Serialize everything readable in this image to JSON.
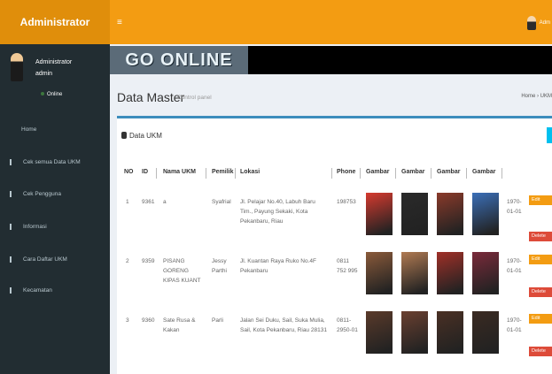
{
  "header": {
    "brand": "Administrator",
    "menu_icon": "hamburger-icon",
    "user_name": "Adm"
  },
  "sidebar": {
    "user": {
      "name_line1": "Administrator",
      "name_line2": "admin",
      "status": "Online"
    },
    "items": [
      {
        "label": "Home"
      },
      {
        "label": "Cek semua Data UKM"
      },
      {
        "label": "Cek Pengguna"
      },
      {
        "label": "Informasi"
      },
      {
        "label": "Cara Daftar UKM"
      },
      {
        "label": "Kecamatan"
      }
    ]
  },
  "banner": {
    "text": "GO ONLINE"
  },
  "content": {
    "title": "Data Master",
    "subtitle": "Control panel",
    "breadcrumb": "Home › UKM"
  },
  "box": {
    "title": "Data UKM",
    "columns": [
      "NO",
      "ID",
      "Nama UKM",
      "Pemilik",
      "Lokasi",
      "Phone",
      "Gambar",
      "Gambar",
      "Gambar",
      "Gambar"
    ],
    "rows": [
      {
        "no": "1",
        "id": "9361",
        "nama": "a",
        "pemilik": "Syafrial",
        "lokasi": "Jl. Pelajar No.40, Labuh Baru Tim., Payung Sekaki, Kota Pekanbaru, Riau",
        "phone": "198753",
        "date": "1970-01-01",
        "thumb_colors": [
          "#d63a2f",
          "#2a2a2a",
          "#8a3a2a",
          "#3b6fb8"
        ]
      },
      {
        "no": "2",
        "id": "9359",
        "nama": "PISANG GORENG KIPAS KUANT",
        "pemilik": "Jessy Parthi",
        "lokasi": "Jl. Kuantan Raya Ruko No.4F Pekanbaru",
        "phone": "0811 752 995",
        "date": "1970-01-01",
        "thumb_colors": [
          "#8a5a3a",
          "#b07a52",
          "#a03028",
          "#7a2a3a"
        ]
      },
      {
        "no": "3",
        "id": "9360",
        "nama": "Sate Rusa & Kakan",
        "pemilik": "Parli",
        "lokasi": "Jalan Sei Duku, Sail, Suka Mulia, Sail, Kota Pekanbaru, Riau 28131",
        "phone": "0811-2950-01",
        "date": "1970-01-01",
        "thumb_colors": [
          "#5a3a2a",
          "#6a4030",
          "#4a3024",
          "#3a2a22"
        ]
      }
    ],
    "edit_label": "Edit",
    "delete_label": "Delete"
  }
}
